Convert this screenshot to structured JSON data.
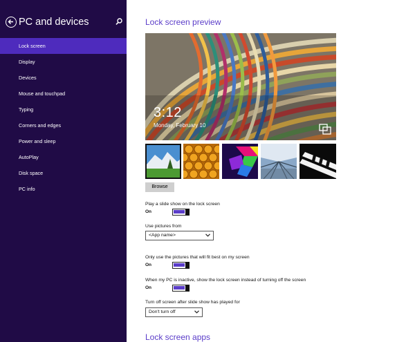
{
  "sidebar": {
    "title": "PC and devices",
    "back_icon": "back-arrow-icon",
    "search_icon": "search-icon",
    "items": [
      {
        "label": "Lock screen",
        "selected": true
      },
      {
        "label": "Display"
      },
      {
        "label": "Devices"
      },
      {
        "label": "Mouse and touchpad"
      },
      {
        "label": "Typing"
      },
      {
        "label": "Corners and edges"
      },
      {
        "label": "Power and sleep"
      },
      {
        "label": "AutoPlay"
      },
      {
        "label": "Disk space"
      },
      {
        "label": "PC info"
      }
    ]
  },
  "main": {
    "preview_title": "Lock screen preview",
    "preview": {
      "time": "3:12",
      "date": "Monday, February 10",
      "icon": "slideshow-icon"
    },
    "thumbnails": [
      "landscape",
      "honeycomb",
      "geometric",
      "railway",
      "piano"
    ],
    "browse_label": "Browse",
    "slideshow": {
      "label": "Play a slide show on the lock screen",
      "state": "On"
    },
    "use_pictures": {
      "label": "Use pictures from",
      "value": "<App name>"
    },
    "fit_best": {
      "label": "Only use the pictures that will fit best on my screen",
      "state": "On"
    },
    "inactive": {
      "label": "When my PC is inactive, show the lock screen instead of turning off the screen",
      "state": "On"
    },
    "turn_off": {
      "label": "Turn off screen after slide show has played for",
      "value": "Don't turn off"
    },
    "apps_title": "Lock screen apps"
  },
  "colors": {
    "sidebar_bg": "#200b46",
    "selected_bg": "#4e2bbd",
    "accent": "#5b3dc9"
  }
}
